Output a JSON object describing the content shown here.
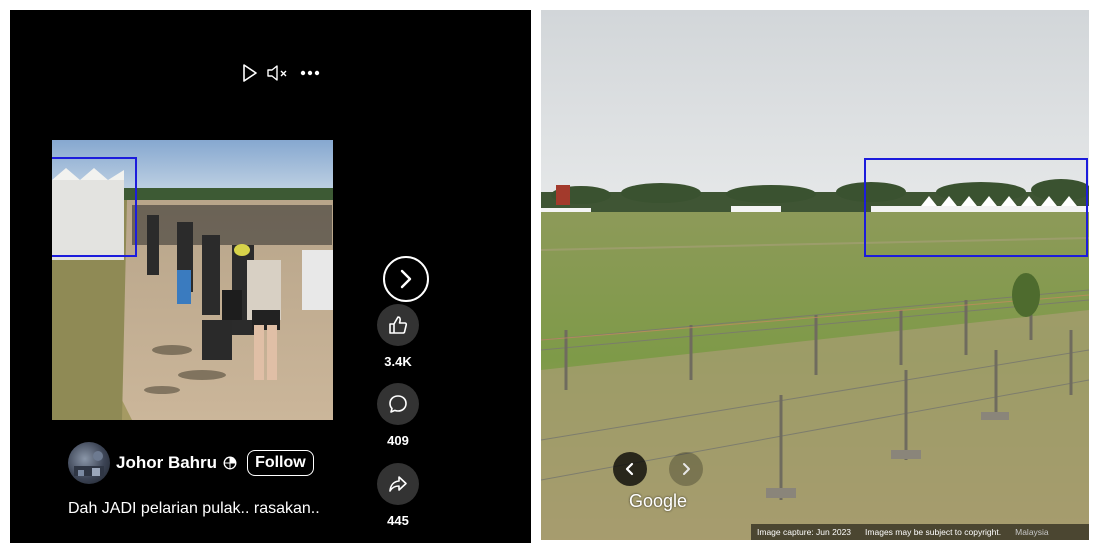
{
  "left_post": {
    "controls": {
      "play_icon": "play-icon",
      "mute_icon": "muted-speaker-icon",
      "more_icon": "more-dots-icon"
    },
    "next_icon": "chevron-right-icon",
    "actions": [
      {
        "icon": "thumbs-up-icon",
        "count": "3.4K"
      },
      {
        "icon": "comment-icon",
        "count": "409"
      },
      {
        "icon": "share-icon",
        "count": "445"
      }
    ],
    "author": {
      "name": "Johor Bahru",
      "privacy_icon": "globe-icon",
      "follow_label": "Follow"
    },
    "caption": "Dah JADI pelarian pulak.. rasakan.."
  },
  "street_view": {
    "logo": "Google",
    "prev_icon": "chevron-left-icon",
    "next_icon": "chevron-right-icon",
    "capture_date": "Image capture: Jun 2023",
    "copyright": "Images may be subject to copyright.",
    "region": "Malaysia"
  },
  "colors": {
    "highlight": "#1c1cdc",
    "dark_background": "#000000"
  }
}
